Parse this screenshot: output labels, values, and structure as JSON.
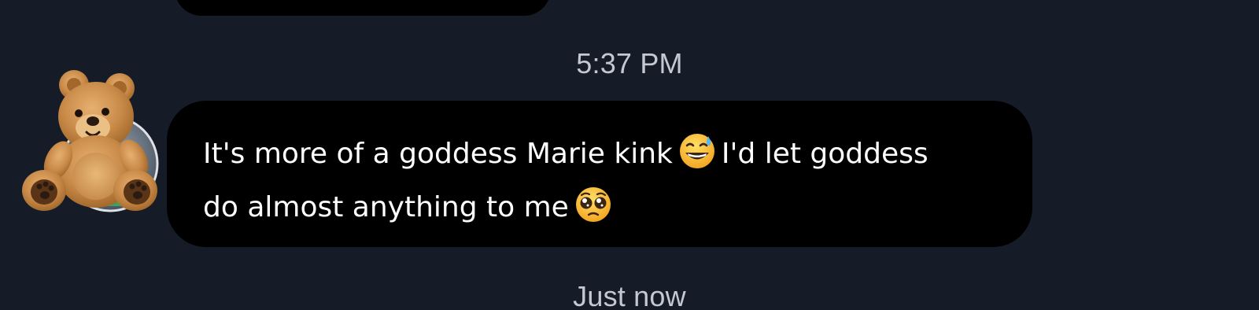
{
  "conversation": {
    "previous_message": {
      "visible": true
    },
    "timestamp_top": "5:37 PM",
    "message": {
      "sender_avatar_icon": "teddy-bear-icon",
      "line1_part1": "It's more of a goddess Marie kink",
      "emoji1_icon": "grinning-face-with-sweat-icon",
      "line1_part2": "I'd let goddess",
      "line2_part1": "do almost anything to me",
      "emoji2_icon": "pleading-face-icon"
    },
    "timestamp_bottom": "Just now"
  },
  "colors": {
    "background": "#151c27",
    "bubble": "#000000",
    "message_text": "#ffffff",
    "timestamp_text": "#c3c8d1"
  }
}
